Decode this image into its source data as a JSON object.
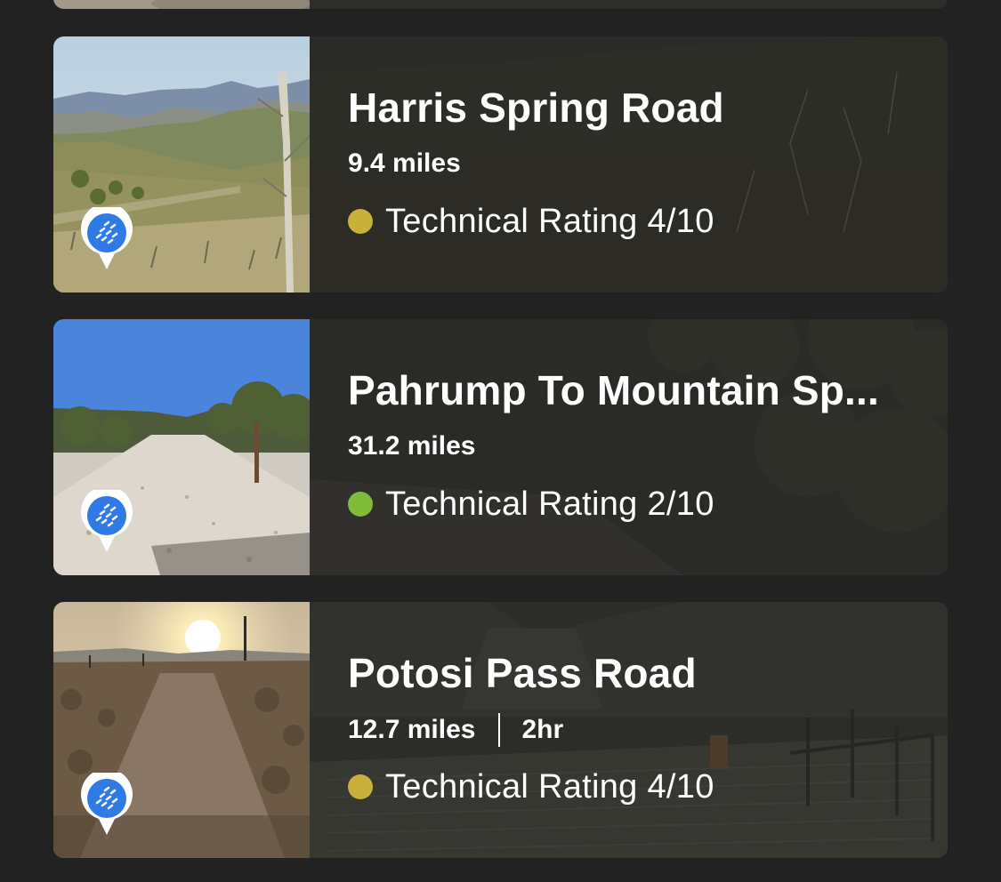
{
  "trails": [
    {
      "name": "Harris Spring Road",
      "distance": "9.4 miles",
      "duration": "",
      "rating_label": "Technical Rating 4/10",
      "rating_color": "#c9b03a"
    },
    {
      "name": "Pahrump To Mountain Sp...",
      "distance": "31.2 miles",
      "duration": "",
      "rating_label": "Technical Rating 2/10",
      "rating_color": "#7ebc3a"
    },
    {
      "name": "Potosi Pass Road",
      "distance": "12.7 miles",
      "duration": "2hr",
      "rating_label": "Technical Rating 4/10",
      "rating_color": "#c9b03a"
    }
  ],
  "icons": {
    "trail_type": "trail-map-pin-icon",
    "rating_dot": "rating-dot-icon"
  },
  "colors": {
    "background": "#222222",
    "pin_blue": "#2f7ae5"
  }
}
